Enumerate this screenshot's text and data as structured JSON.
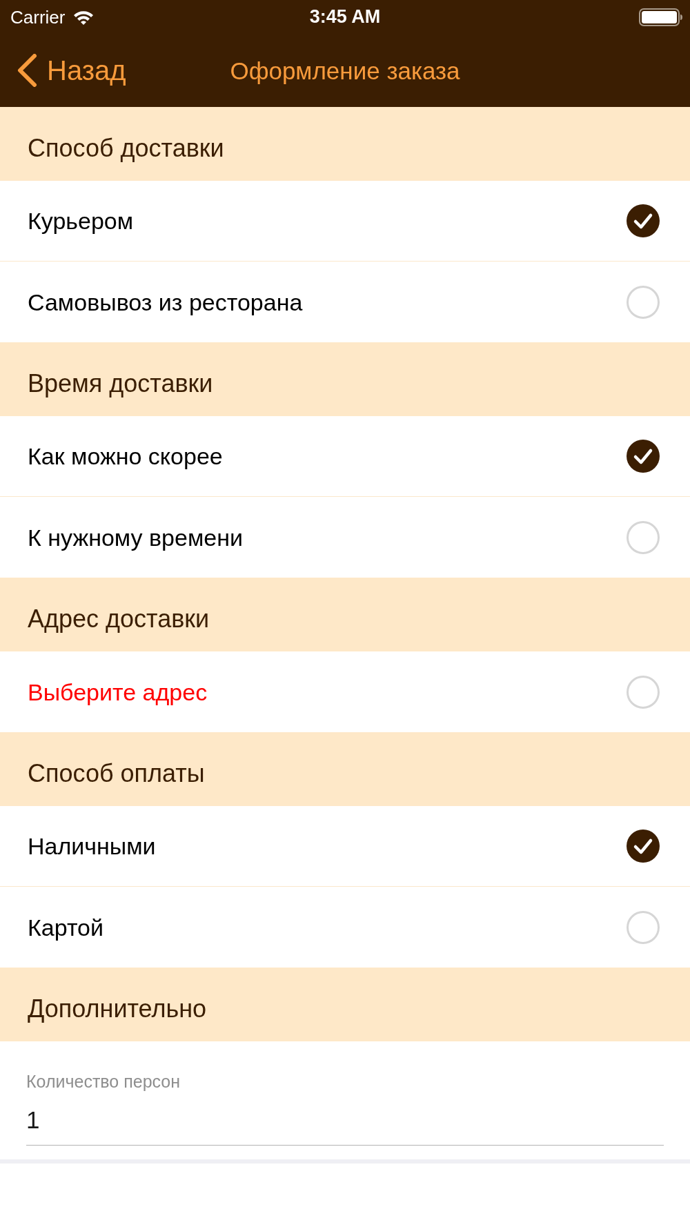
{
  "status_bar": {
    "carrier": "Carrier",
    "time": "3:45 AM"
  },
  "nav_bar": {
    "back_label": "Назад",
    "title": "Оформление заказа"
  },
  "sections": [
    {
      "title": "Способ доставки",
      "options": [
        {
          "label": "Курьером",
          "kind": "choice",
          "selected": true
        },
        {
          "label": "Самовывоз из ресторана",
          "kind": "choice",
          "selected": false
        }
      ]
    },
    {
      "title": "Время доставки",
      "options": [
        {
          "label": "Как можно скорее",
          "kind": "choice",
          "selected": true
        },
        {
          "label": "К нужному времени",
          "kind": "choice",
          "selected": false
        }
      ]
    },
    {
      "title": "Адрес доставки",
      "options": [
        {
          "label": "Выберите адрес",
          "kind": "prompt",
          "selected": false
        }
      ]
    },
    {
      "title": "Способ оплаты",
      "options": [
        {
          "label": "Наличными",
          "kind": "choice",
          "selected": true
        },
        {
          "label": "Картой",
          "kind": "choice",
          "selected": false
        }
      ]
    },
    {
      "title": "Дополнительно",
      "fields": [
        {
          "label": "Количество персон",
          "value": "1"
        }
      ]
    }
  ]
}
